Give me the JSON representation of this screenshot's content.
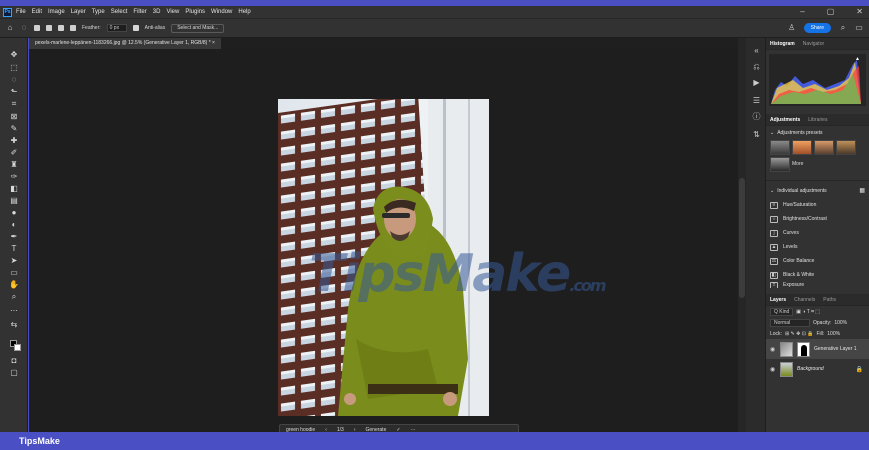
{
  "app": {
    "logo": "Ps"
  },
  "menu": [
    "File",
    "Edit",
    "Image",
    "Layer",
    "Type",
    "Select",
    "Filter",
    "3D",
    "View",
    "Plugins",
    "Window",
    "Help"
  ],
  "window_controls": {
    "minimize": "–",
    "maximize": "▢",
    "close": "✕"
  },
  "options": {
    "feather_label": "Feather:",
    "feather_value": "0 px",
    "antialias_label": "Anti-alias",
    "select_mask": "Select and Mask...",
    "share": "Share"
  },
  "document": {
    "tab": "pexels-marlene-leppänen-1183266.jpg @ 12.5% (Generative Layer 1, RGB/8) *",
    "close": "×"
  },
  "context_bar": {
    "prompt": "green hoodie",
    "nav_prev": "‹",
    "page": "1/3",
    "nav_next": "›",
    "generate": "Generate",
    "more": "···"
  },
  "watermark": {
    "main": "TipsMake",
    "suffix": ".com"
  },
  "panels": {
    "top_tabs": [
      "Histogram",
      "Navigator"
    ],
    "adj_tabs": [
      "Adjustments",
      "Libraries"
    ],
    "presets_title": "Adjustments presets",
    "presets_more": "More",
    "individual_title": "Individual adjustments",
    "adjustments": [
      "Hue/Saturation",
      "Brightness/Contrast",
      "Curves",
      "Levels",
      "Color Balance",
      "Black & White",
      "Exposure"
    ]
  },
  "layers": {
    "tabs": [
      "Layers",
      "Channels",
      "Paths"
    ],
    "kind": "Q Kind",
    "blend_mode": "Normal",
    "opacity_label": "Opacity:",
    "opacity_value": "100%",
    "lock_label": "Lock:",
    "fill_label": "Fill:",
    "fill_value": "100%",
    "items": [
      {
        "name": "Generative Layer 1",
        "selected": true
      },
      {
        "name": "Background",
        "selected": false
      }
    ]
  },
  "footer": {
    "brand": "TipsMake"
  },
  "colors": {
    "accent": "#1473e6",
    "frame": "#4a4fc4",
    "ui_bg": "#323232",
    "canvas_bg": "#1e1e1e"
  }
}
